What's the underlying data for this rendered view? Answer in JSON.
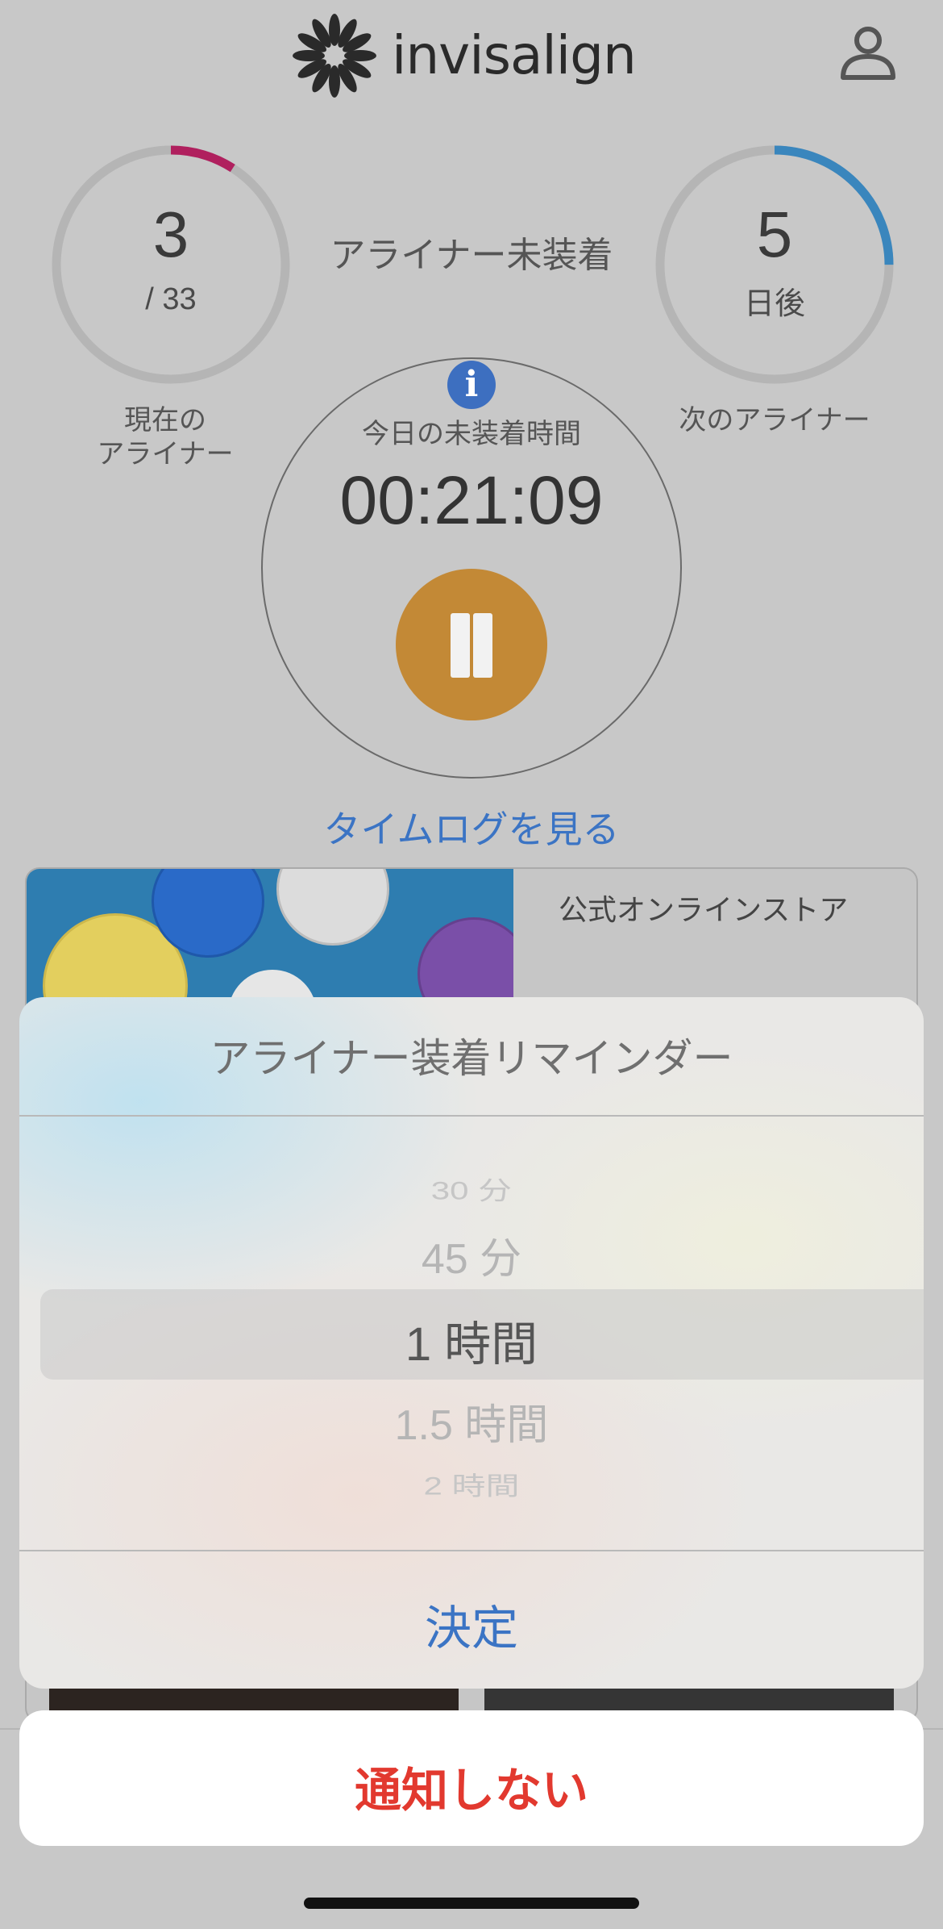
{
  "header": {
    "brand": "invisalign",
    "logo_icon": "flower-icon",
    "profile_icon": "user-icon"
  },
  "current_aligner": {
    "number": "3",
    "total": "/ 33",
    "caption_line1": "現在の",
    "caption_line2": "アライナー",
    "progress": 0.0909,
    "color": "#b0205e"
  },
  "status": "アライナー未装着",
  "next_aligner": {
    "days": "5",
    "unit": "日後",
    "caption": "次のアライナー",
    "progress": 0.25,
    "color": "#3a86bd"
  },
  "timer": {
    "info_icon": "i",
    "label": "今日の未装着時間",
    "value": "00:21:09",
    "pause_icon": "pause-icon",
    "accent": "#c38936"
  },
  "timelog_link": "タイムログを見る",
  "store": {
    "title": "公式オンラインストア",
    "cart_icon": "cart-icon"
  },
  "reminder_sheet": {
    "title": "アライナー装着リマインダー",
    "options": [
      {
        "label": "30 分"
      },
      {
        "label": "45 分"
      },
      {
        "label": "1 時間"
      },
      {
        "label": "1.5 時間"
      },
      {
        "label": "2 時間"
      }
    ],
    "selected_index": 2,
    "confirm_label": "決定",
    "cancel_label": "通知しない",
    "link_color": "#3b74c4",
    "destructive_color": "#e2392f"
  }
}
